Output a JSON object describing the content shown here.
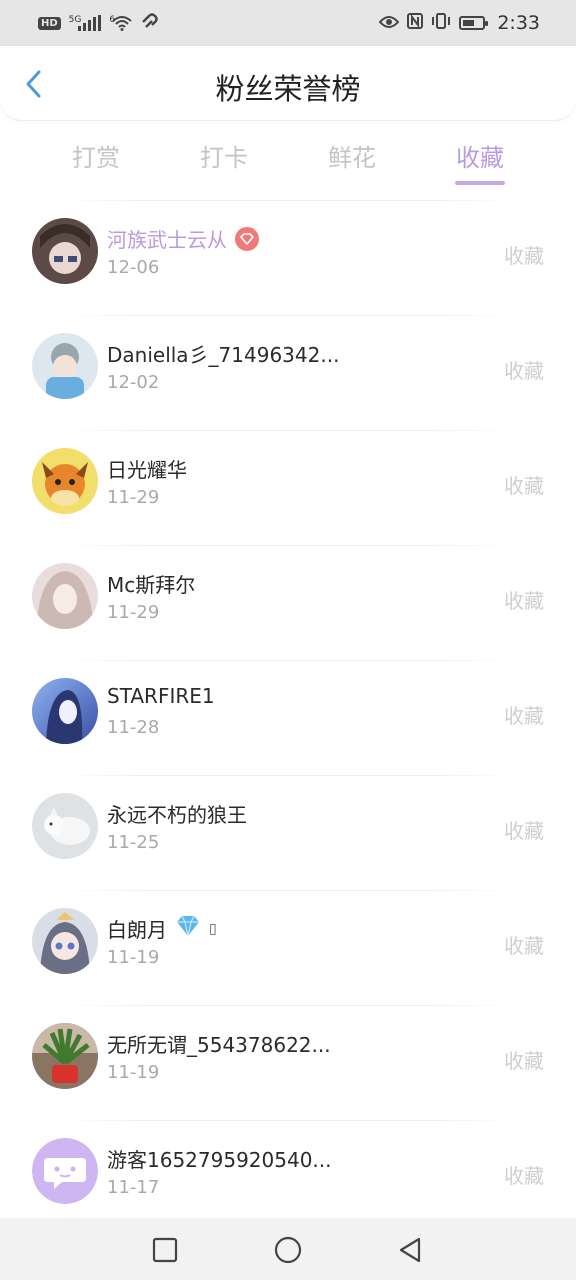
{
  "status_bar": {
    "hd_label": "HD",
    "net_label": "5G",
    "wifi_label": "6",
    "time": "2:33"
  },
  "header": {
    "title": "粉丝荣誉榜"
  },
  "tabs": [
    {
      "label": "打赏"
    },
    {
      "label": "打卡"
    },
    {
      "label": "鲜花"
    },
    {
      "label": "收藏"
    }
  ],
  "active_tab_index": 3,
  "colors": {
    "accent": "#b99ce0",
    "muted_text": "#c4c4c4",
    "date_text": "#a9a9a9",
    "action_text": "#cfcfcf"
  },
  "fans": [
    {
      "name": "河族武士云从",
      "date": "12-06",
      "action": "收藏",
      "vip": true,
      "badge_icon": "heart-gem-icon"
    },
    {
      "name": "Daniella彡_71496342...",
      "date": "12-02",
      "action": "收藏"
    },
    {
      "name": "日光耀华",
      "date": "11-29",
      "action": "收藏"
    },
    {
      "name": "Mc斯拜尔",
      "date": "11-29",
      "action": "收藏"
    },
    {
      "name": "STARFIRE1",
      "date": "11-28",
      "action": "收藏"
    },
    {
      "name": "永远不朽的狼王",
      "date": "11-25",
      "action": "收藏"
    },
    {
      "name": "白朗月",
      "date": "11-19",
      "action": "收藏",
      "badge_icon": "diamond-icon",
      "extra_glyph": "▯"
    },
    {
      "name": "无所无谓_554378622...",
      "date": "11-19",
      "action": "收藏"
    },
    {
      "name": "游客1652795920540...",
      "date": "11-17",
      "action": "收藏"
    }
  ]
}
